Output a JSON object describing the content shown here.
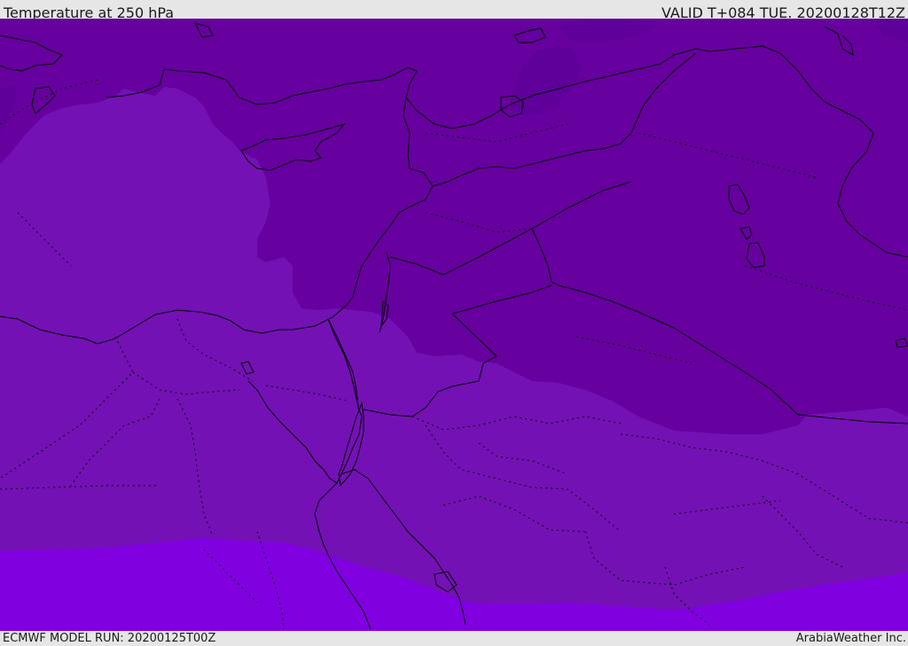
{
  "header": {
    "title": "Temperature at 250 hPa",
    "valid_time": "VALID T+084 TUE. 20200128T12Z"
  },
  "footer": {
    "model_run": "ECMWF MODEL RUN: 20200125T00Z",
    "credit": "ArabiaWeather Inc."
  },
  "colors": {
    "band_coldest": "#5e0099",
    "band_cold": "#66009e",
    "band_mid": "#7311b5",
    "band_warm": "#8000e0",
    "coastline": "#000000",
    "header_bg": "#e6e6e6"
  }
}
